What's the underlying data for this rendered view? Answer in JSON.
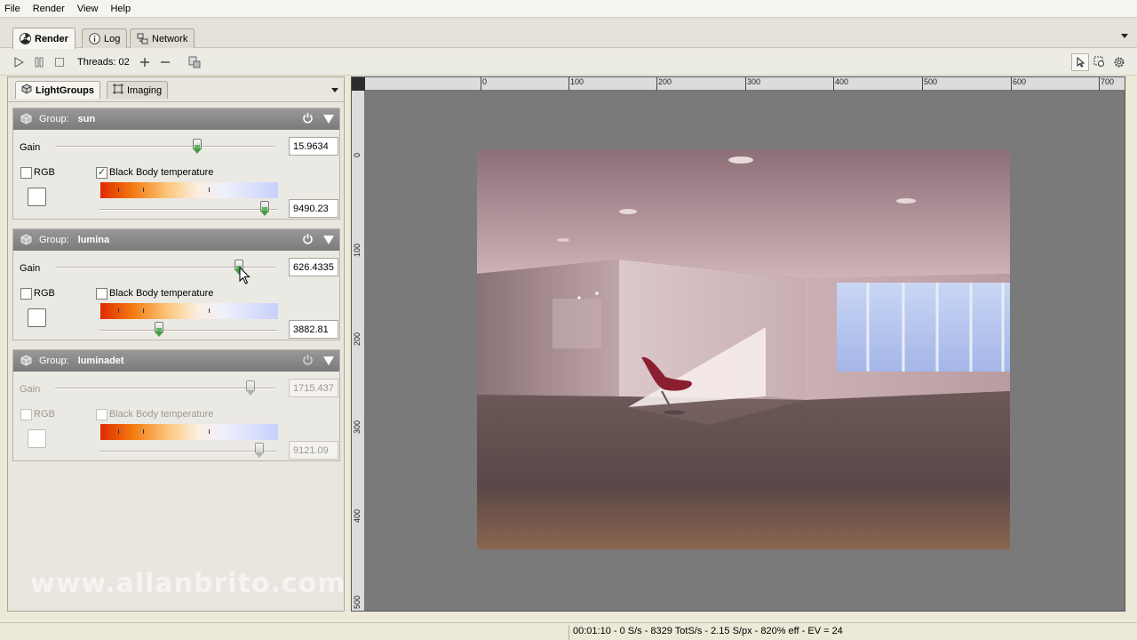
{
  "menu": [
    "File",
    "Render",
    "View",
    "Help"
  ],
  "main_tabs": [
    {
      "label": "Render",
      "icon": "radiation-icon",
      "active": true
    },
    {
      "label": "Log",
      "icon": "info-icon",
      "active": false
    },
    {
      "label": "Network",
      "icon": "network-icon",
      "active": false
    }
  ],
  "toolbar": {
    "threads_label": "Threads: 02"
  },
  "sub_tabs": [
    {
      "label": "LightGroups",
      "icon": "cube-icon",
      "active": true
    },
    {
      "label": "Imaging",
      "icon": "crop-icon",
      "active": false
    }
  ],
  "groups": [
    {
      "label": "Group:",
      "name": "sun",
      "enabled": true,
      "gain_label": "Gain",
      "gain_value": "15.9634",
      "rgb_label": "RGB",
      "rgb_checked": false,
      "bb_label": "Black Body temperature",
      "bb_checked": true,
      "temp_value": "9490.23"
    },
    {
      "label": "Group:",
      "name": "lumina",
      "enabled": true,
      "gain_label": "Gain",
      "gain_value": "626.4335",
      "rgb_label": "RGB",
      "rgb_checked": false,
      "bb_label": "Black Body temperature",
      "bb_checked": false,
      "temp_value": "3882.81"
    },
    {
      "label": "Group:",
      "name": "luminadet",
      "enabled": false,
      "gain_label": "Gain",
      "gain_value": "1715.437",
      "rgb_label": "RGB",
      "rgb_checked": false,
      "bb_label": "Black Body temperature",
      "bb_checked": false,
      "temp_value": "9121.09"
    }
  ],
  "watermark": "www.allanbrito.com",
  "ruler_top_labels": [
    "0",
    "100",
    "200",
    "300",
    "400",
    "500",
    "600",
    "700"
  ],
  "ruler_left_labels": [
    "0",
    "100",
    "200",
    "300",
    "400",
    "500"
  ],
  "status": "00:01:10 - 0 S/s - 8329 TotS/s - 2.15 S/px - 820% eff - EV = 24"
}
